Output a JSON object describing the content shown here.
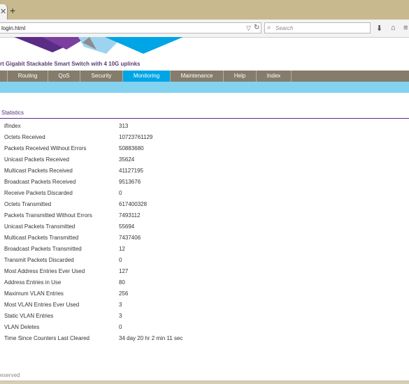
{
  "browser": {
    "close_glyph": "✕",
    "newtab_glyph": "+",
    "url": "login.html",
    "url_dropdown_glyph": "▽",
    "reload_glyph": "↻",
    "search_placeholder": "Search",
    "search_glyph": "⌕",
    "download_glyph": "⬇",
    "home_glyph": "⌂",
    "menu_glyph": "≡"
  },
  "header": {
    "product_title": "rt Gigabit Stackable Smart Switch with 4 10G uplinks",
    "brand_colors": [
      "#5a2c86",
      "#7b3fa0",
      "#9ed3f0",
      "#00a5e5",
      "#8c8c8c"
    ]
  },
  "menu": {
    "items": [
      "",
      "Routing",
      "QoS",
      "Security",
      "Monitoring",
      "Maintenance",
      "Help",
      "Index"
    ],
    "active": "Monitoring",
    "active_color": "#00a5e5"
  },
  "section": {
    "tab_label": "Statistics"
  },
  "stats": [
    {
      "label": "ifIndex",
      "value": "313"
    },
    {
      "label": "Octets Received",
      "value": "10723761129"
    },
    {
      "label": "Packets Received Without Errors",
      "value": "50883680"
    },
    {
      "label": "Unicast Packets Received",
      "value": "35624"
    },
    {
      "label": "Multicast Packets Received",
      "value": "41127195"
    },
    {
      "label": "Broadcast Packets Received",
      "value": "9513676"
    },
    {
      "label": "Receive Packets Discarded",
      "value": "0"
    },
    {
      "label": "Octets Transmitted",
      "value": "617400328"
    },
    {
      "label": "Packets Transmitted Without Errors",
      "value": "7493112"
    },
    {
      "label": "Unicast Packets Transmitted",
      "value": "55694"
    },
    {
      "label": "Multicast Packets Transmitted",
      "value": "7437406"
    },
    {
      "label": "Broadcast Packets Transmitted",
      "value": "12"
    },
    {
      "label": "Transmit Packets Discarded",
      "value": "0"
    },
    {
      "label": "Most Address Entries Ever Used",
      "value": "127"
    },
    {
      "label": "Address Entries in Use",
      "value": "80"
    },
    {
      "label": "Maximum VLAN Entries",
      "value": "256"
    },
    {
      "label": "Most VLAN Entries Ever Used",
      "value": "3"
    },
    {
      "label": "Static VLAN Entries",
      "value": "3"
    },
    {
      "label": "VLAN Deletes",
      "value": "0"
    },
    {
      "label": "Time Since Counters Last Cleared",
      "value": "34 day 20 hr 2 min 11 sec"
    }
  ],
  "footer": {
    "text": "eserved"
  }
}
